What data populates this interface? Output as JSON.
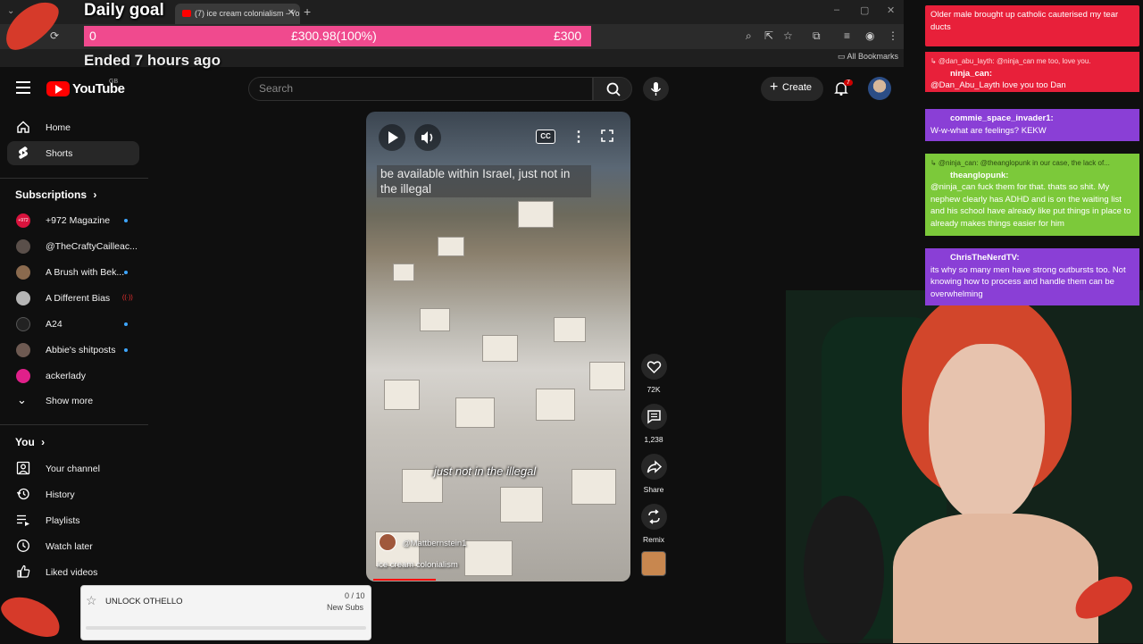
{
  "browser": {
    "tab_title": "(7) ice cream colonialism - YouTube",
    "new_tab": "+",
    "close_tab": "✕",
    "bookmarks_label": "All Bookmarks",
    "win_min": "–",
    "win_max": "▢",
    "win_close": "✕"
  },
  "goal": {
    "title": "Daily goal",
    "start": "0",
    "current": "£300.98(100%)",
    "target": "£300",
    "status": "Ended 7 hours ago",
    "progress": 1.0
  },
  "header": {
    "logo_text": "YouTube",
    "region": "GB",
    "search_placeholder": "Search",
    "create_label": "Create",
    "notification_count": "7"
  },
  "sidebar": {
    "main": [
      {
        "label": "Home",
        "icon": "home-icon"
      },
      {
        "label": "Shorts",
        "icon": "shorts-icon",
        "active": true
      }
    ],
    "subscriptions_title": "Subscriptions",
    "subscriptions_arrow": "›",
    "subscriptions": [
      {
        "label": "+972 Magazine",
        "badge": "+972",
        "live": true,
        "color": "#d8133d"
      },
      {
        "label": "@TheCraftyCailleac...",
        "live": false,
        "color": "#5a4f4a"
      },
      {
        "label": "A Brush with Bek...",
        "live": true,
        "color": "#8a6a4e"
      },
      {
        "label": "A Different Bias",
        "live": true,
        "color": "#b5b5b5"
      },
      {
        "label": "A24",
        "live": true,
        "color": "#222222"
      },
      {
        "label": "Abbie's shitposts",
        "live": true,
        "color": "#6e5a52"
      },
      {
        "label": "ackerlady",
        "live": false,
        "color": "#e0208a"
      }
    ],
    "show_more": "Show more",
    "you_title": "You",
    "you_arrow": "›",
    "you_items": [
      {
        "label": "Your channel",
        "icon": "your-channel-icon"
      },
      {
        "label": "History",
        "icon": "history-icon"
      },
      {
        "label": "Playlists",
        "icon": "playlists-icon"
      },
      {
        "label": "Watch later",
        "icon": "watch-later-icon"
      },
      {
        "label": "Liked videos",
        "icon": "liked-videos-icon"
      }
    ]
  },
  "short": {
    "caption_top": "be available within Israel, just not in the illegal",
    "caption_mid": "just not in the illegal",
    "creator_handle": "@Mattbernstein1",
    "title": "ice cream colonialism",
    "cc_label": "CC",
    "more_label": "⋮",
    "progress": 0.25
  },
  "actions": {
    "likes": "72K",
    "comments": "1,238",
    "share": "Share",
    "remix": "Remix"
  },
  "chat": [
    {
      "reply": "",
      "user": "",
      "text": "Older male brought up catholic cauterised my tear ducts",
      "color": "#e8203a"
    },
    {
      "reply": "↳ @dan_abu_layth: @ninja_can me too, love you.",
      "user": "ninja_can:",
      "text": "@Dan_Abu_Layth love you too Dan",
      "color": "#e8203a"
    },
    {
      "reply": "",
      "user": "commie_space_invader1:",
      "text": "W-w-what are feelings? KEKW",
      "color": "#8a3fd6"
    },
    {
      "reply": "↳ @ninja_can: @theanglopunk in our case, the lack of...",
      "user": "theanglopunk:",
      "text": "@ninja_can fuck them for that. thats so shit. My nephew clearly has ADHD and is on the waiting list and his school have already like put things in place to already makes things easier for him",
      "color": "#7cc93a"
    },
    {
      "reply": "",
      "user": "ChrisTheNerdTV:",
      "text": "its why so many men have strong outbursts too. Not knowing how to process and handle them can be overwhelming",
      "color": "#8a3fd6"
    }
  ],
  "unlock": {
    "label": "UNLOCK OTHELLO",
    "count": "0 / 10",
    "unit": "New Subs",
    "progress": 0
  }
}
